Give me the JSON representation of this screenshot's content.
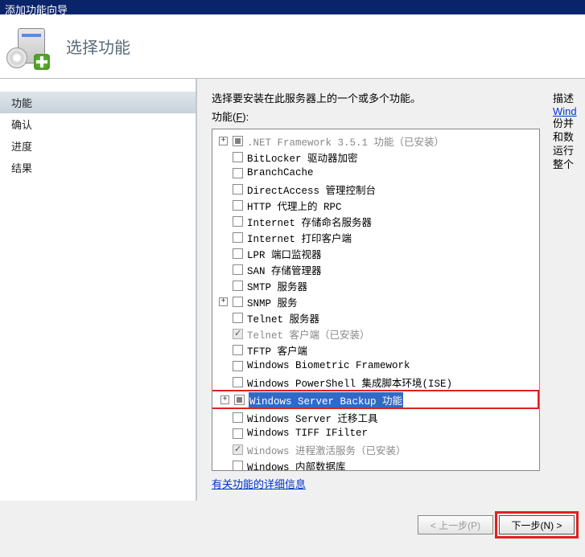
{
  "window": {
    "title": "添加功能向导"
  },
  "header": {
    "title": "选择功能"
  },
  "sidebar": {
    "items": [
      {
        "label": "功能",
        "active": true
      },
      {
        "label": "确认",
        "active": false
      },
      {
        "label": "进度",
        "active": false
      },
      {
        "label": "结果",
        "active": false
      }
    ]
  },
  "main": {
    "instruction": "选择要安装在此服务器上的一个或多个功能。",
    "features_label_pre": "功能(",
    "features_label_key": "F",
    "features_label_post": "):",
    "desc_heading": "描述",
    "desc_link": "Wind",
    "desc_text_lines": [
      "份并",
      "和数",
      "运行",
      "整个"
    ],
    "more_link": "有关功能的详细信息",
    "tree": [
      {
        "expander": "+",
        "check": "tri",
        "label": ".NET Framework 3.5.1 功能",
        "suffix": "（已安装）",
        "installed": true
      },
      {
        "expander": "",
        "check": "off",
        "label": "BitLocker 驱动器加密"
      },
      {
        "expander": "",
        "check": "off",
        "label": "BranchCache"
      },
      {
        "expander": "",
        "check": "off",
        "label": "DirectAccess 管理控制台"
      },
      {
        "expander": "",
        "check": "off",
        "label": "HTTP 代理上的 RPC"
      },
      {
        "expander": "",
        "check": "off",
        "label": "Internet 存储命名服务器"
      },
      {
        "expander": "",
        "check": "off",
        "label": "Internet 打印客户端"
      },
      {
        "expander": "",
        "check": "off",
        "label": "LPR 端口监视器"
      },
      {
        "expander": "",
        "check": "off",
        "label": "SAN 存储管理器"
      },
      {
        "expander": "",
        "check": "off",
        "label": "SMTP 服务器"
      },
      {
        "expander": "+",
        "check": "off",
        "label": "SNMP 服务"
      },
      {
        "expander": "",
        "check": "off",
        "label": "Telnet 服务器"
      },
      {
        "expander": "",
        "check": "chk-dis",
        "label": "Telnet 客户端",
        "suffix": "（已安装）",
        "installed": true
      },
      {
        "expander": "",
        "check": "off",
        "label": "TFTP 客户端"
      },
      {
        "expander": "",
        "check": "off",
        "label": "Windows Biometric Framework"
      },
      {
        "expander": "",
        "check": "off",
        "label": "Windows PowerShell 集成脚本环境(ISE)"
      },
      {
        "expander": "+",
        "check": "tri",
        "label": "Windows Server Backup 功能",
        "selected": true,
        "highlight": true
      },
      {
        "expander": "",
        "check": "off",
        "label": "Windows Server 迁移工具"
      },
      {
        "expander": "",
        "check": "off",
        "label": "Windows TIFF IFilter"
      },
      {
        "expander": "",
        "check": "chk-dis",
        "label": "Windows 进程激活服务",
        "suffix": "（已安装）",
        "installed": true
      },
      {
        "expander": "",
        "check": "off",
        "label": "Windows 内部数据库"
      }
    ]
  },
  "footer": {
    "prev": "< 上一步(P)",
    "next": "下一步(N) >",
    "highlight_next": true
  },
  "colors": {
    "highlight_red": "#e02020",
    "selection_blue": "#316ac5",
    "titlebar_blue": "#0a246a"
  }
}
